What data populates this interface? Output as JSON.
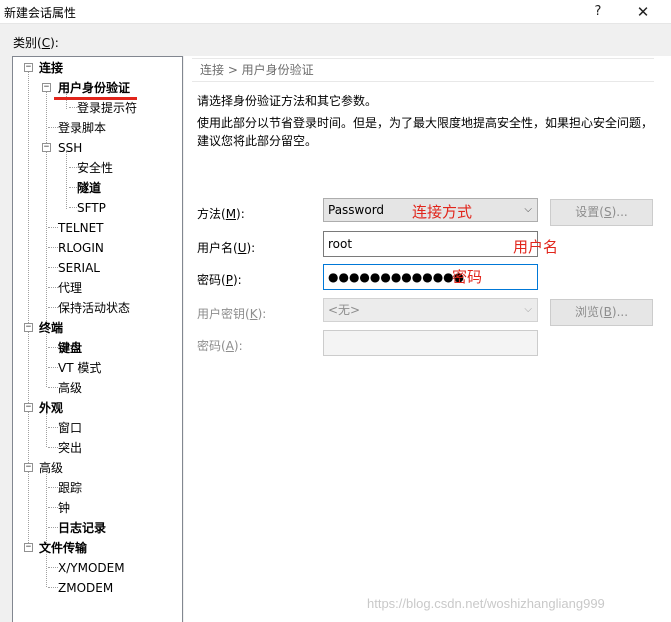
{
  "window": {
    "title": "新建会话属性",
    "help_glyph": "?",
    "close_glyph": "✕"
  },
  "category": {
    "label": "类别(C):",
    "label_main": "类别(",
    "label_key": "C",
    "label_end": "):"
  },
  "tree": {
    "items": [
      {
        "label": "连接",
        "bold": true
      },
      {
        "label": "用户身份验证",
        "bold": true,
        "selected": true
      },
      {
        "label": "登录提示符"
      },
      {
        "label": "登录脚本"
      },
      {
        "label": "SSH"
      },
      {
        "label": "安全性"
      },
      {
        "label": "隧道",
        "bold": true
      },
      {
        "label": "SFTP"
      },
      {
        "label": "TELNET"
      },
      {
        "label": "RLOGIN"
      },
      {
        "label": "SERIAL"
      },
      {
        "label": "代理"
      },
      {
        "label": "保持活动状态"
      },
      {
        "label": "终端",
        "bold": true
      },
      {
        "label": "键盘",
        "bold": true
      },
      {
        "label": "VT 模式"
      },
      {
        "label": "高级"
      },
      {
        "label": "外观",
        "bold": true
      },
      {
        "label": "窗口"
      },
      {
        "label": "突出"
      },
      {
        "label": "高级"
      },
      {
        "label": "跟踪"
      },
      {
        "label": "钟"
      },
      {
        "label": "日志记录",
        "bold": true
      },
      {
        "label": "文件传输",
        "bold": true
      },
      {
        "label": "X/YMODEM"
      },
      {
        "label": "ZMODEM"
      }
    ],
    "expander_minus": "−"
  },
  "breadcrumb": "连接 > 用户身份验证",
  "description": {
    "line1": "请选择身份验证方法和其它参数。",
    "line2": "使用此部分以节省登录时间。但是，为了最大限度地提高安全性，如果担心安全问题，",
    "line3": "建议您将此部分留空。"
  },
  "form": {
    "method": {
      "label_main": "方法(",
      "label_key": "M",
      "label_end": "):",
      "value": "Password",
      "button_main": "设置(",
      "button_key": "S",
      "button_end": ")..."
    },
    "username": {
      "label_main": "用户名(",
      "label_key": "U",
      "label_end": "):",
      "value": "root"
    },
    "password": {
      "label_main": "密码(",
      "label_key": "P",
      "label_end": "):",
      "value": "●●●●●●●●●●●●●"
    },
    "user_key": {
      "label_main": "用户密钥(",
      "label_key": "K",
      "label_end": "):",
      "value": "<无>",
      "button_main": "浏览(",
      "button_key": "B",
      "button_end": ")..."
    },
    "passphrase": {
      "label_main": "密码(",
      "label_key": "A",
      "label_end": "):",
      "value": ""
    },
    "dropdown_arrow": "⌵"
  },
  "annotations": {
    "method": "连接方式",
    "username": "用户名",
    "password": "密码"
  },
  "watermark": "https://blog.csdn.net/woshizhangliang999",
  "colors": {
    "annotation_red": "#e1251b",
    "focus_blue": "#0078d7"
  }
}
